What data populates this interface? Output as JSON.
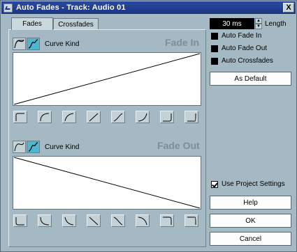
{
  "window": {
    "title": "Auto Fades - Track: Audio 01",
    "close_label": "X"
  },
  "tabs": [
    {
      "label": "Fades"
    },
    {
      "label": "Crossfades"
    }
  ],
  "fade_in": {
    "title": "Fade In",
    "curve_kind_label": "Curve Kind",
    "curve_kinds": [
      "linear-curve-icon",
      "spline-curve-icon"
    ],
    "selected_curve_kind": "spline-curve-icon"
  },
  "fade_out": {
    "title": "Fade Out",
    "curve_kind_label": "Curve Kind",
    "curve_kinds": [
      "linear-curve-icon",
      "spline-curve-icon"
    ],
    "selected_curve_kind": "spline-curve-icon"
  },
  "length": {
    "value": "30 ms",
    "label": "Length"
  },
  "options": {
    "auto_fade_in": {
      "label": "Auto Fade In",
      "checked": true
    },
    "auto_fade_out": {
      "label": "Auto Fade Out",
      "checked": true
    },
    "auto_crossfades": {
      "label": "Auto Crossfades",
      "checked": true
    },
    "use_project_settings": {
      "label": "Use Project Settings",
      "checked": true
    }
  },
  "buttons": {
    "as_default": "As Default",
    "help": "Help",
    "ok": "OK",
    "cancel": "Cancel"
  },
  "colors": {
    "titlebar": "#1c3580",
    "background": "#a4b9c3",
    "selected_curve": "#4fb6cf"
  }
}
